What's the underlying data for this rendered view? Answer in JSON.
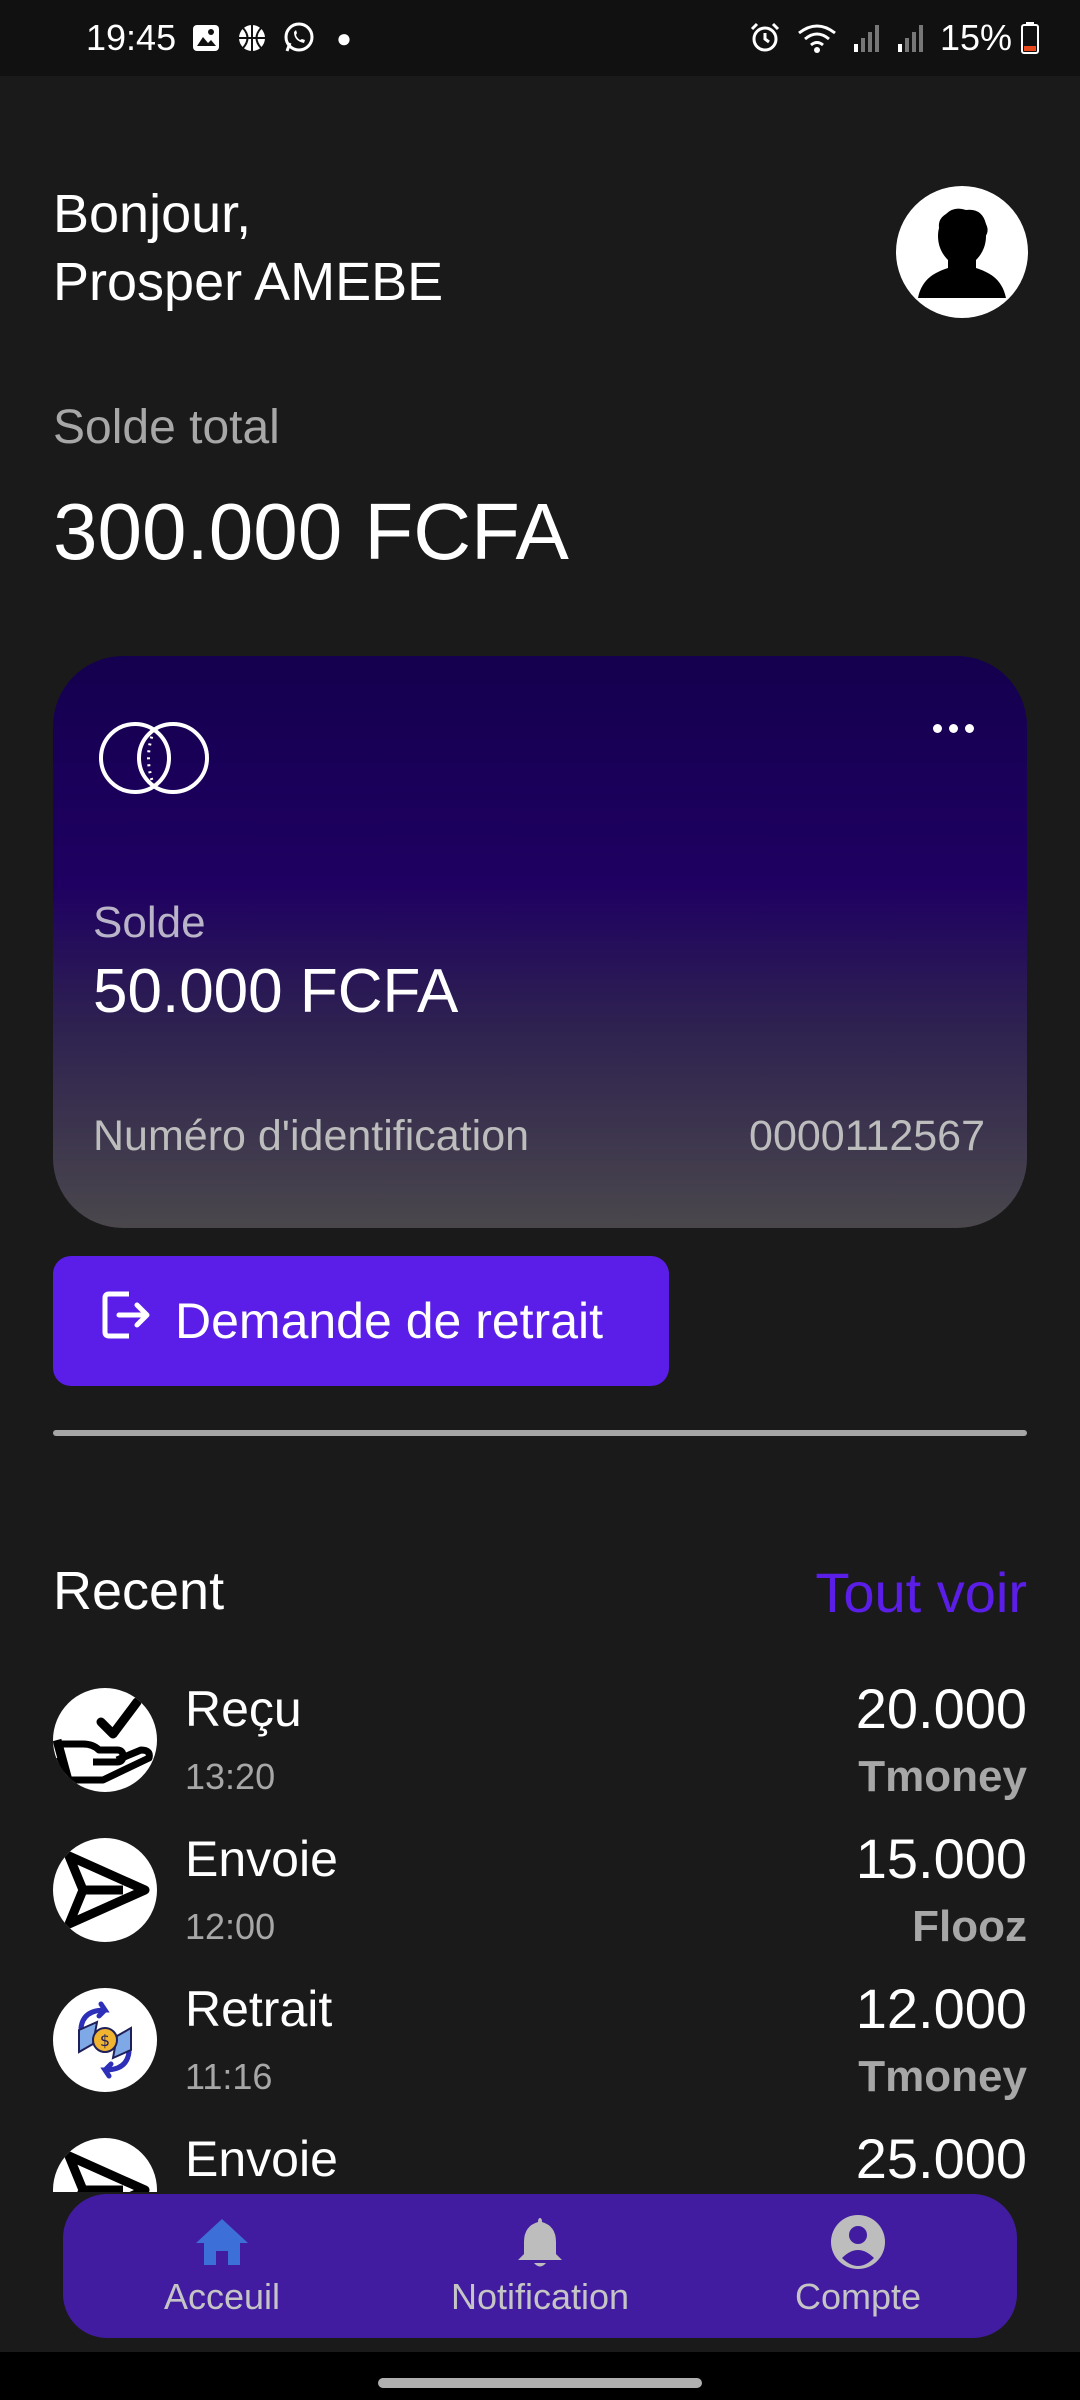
{
  "status_bar": {
    "time": "19:45",
    "battery": "15%",
    "left_icons": [
      "gallery-icon",
      "basketball-icon",
      "whatsapp-icon",
      "dot-icon"
    ],
    "right_icons": [
      "alarm-icon",
      "wifi-icon",
      "signal-icon",
      "signal-icon",
      "battery-icon"
    ]
  },
  "header": {
    "greeting_line1": "Bonjour,",
    "greeting_line2": "Prosper AMEBE",
    "avatar_icon": "user-silhouette-icon"
  },
  "balance": {
    "label": "Solde total",
    "amount": "300.000 FCFA"
  },
  "card": {
    "logo_icon": "card-circles-icon",
    "menu_icon": "more-horizontal-icon",
    "balance_label": "Solde",
    "balance_value": "50.000 FCFA",
    "id_label": "Numéro d'identification",
    "id_value": "0000112567"
  },
  "withdraw_button": {
    "label": "Demande de retrait",
    "icon": "logout-icon",
    "color": "#5b1ee8"
  },
  "recent": {
    "title": "Recent",
    "see_all": "Tout voir",
    "transactions": [
      {
        "title": "Reçu",
        "time": "13:20",
        "amount": "20.000",
        "provider": "Tmoney",
        "icon": "hand-check-icon"
      },
      {
        "title": "Envoie",
        "time": "12:00",
        "amount": "15.000",
        "provider": "Flooz",
        "icon": "send-icon"
      },
      {
        "title": "Retrait",
        "time": "11:16",
        "amount": "12.000",
        "provider": "Tmoney",
        "icon": "money-exchange-icon"
      },
      {
        "title": "Envoie",
        "time": "",
        "amount": "25.000",
        "provider": "",
        "icon": "send-icon"
      }
    ]
  },
  "bottom_nav": {
    "items": [
      {
        "label": "Acceuil",
        "icon": "home-icon",
        "active": true
      },
      {
        "label": "Notification",
        "icon": "bell-icon",
        "active": false
      },
      {
        "label": "Compte",
        "icon": "account-circle-icon",
        "active": false
      }
    ],
    "background": "#421ca0"
  }
}
